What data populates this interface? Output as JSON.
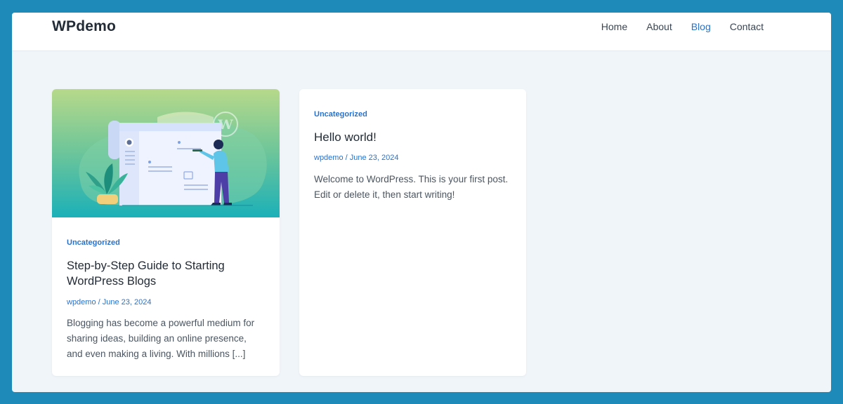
{
  "header": {
    "site_title": "WPdemo",
    "nav": {
      "home": "Home",
      "about": "About",
      "blog": "Blog",
      "contact": "Contact"
    },
    "active_nav": "Blog"
  },
  "posts": [
    {
      "category": "Uncategorized",
      "title": "Step-by-Step Guide to Starting WordPress Blogs",
      "author": "wpdemo",
      "separator": "/",
      "date": "June 23, 2024",
      "excerpt": "Blogging has become a powerful medium for sharing ideas, building an online presence, and even making a living. With millions [...]",
      "thumbnail_icon": "blog-illustration"
    },
    {
      "category": "Uncategorized",
      "title": "Hello world!",
      "author": "wpdemo",
      "separator": "/",
      "date": "June 23, 2024",
      "excerpt": "Welcome to WordPress. This is your first post. Edit or delete it, then start writing!"
    }
  ],
  "colors": {
    "frame": "#1e8ab9",
    "page_bg": "#f0f5f9",
    "accent": "#2a72c9",
    "text": "#222b36"
  }
}
